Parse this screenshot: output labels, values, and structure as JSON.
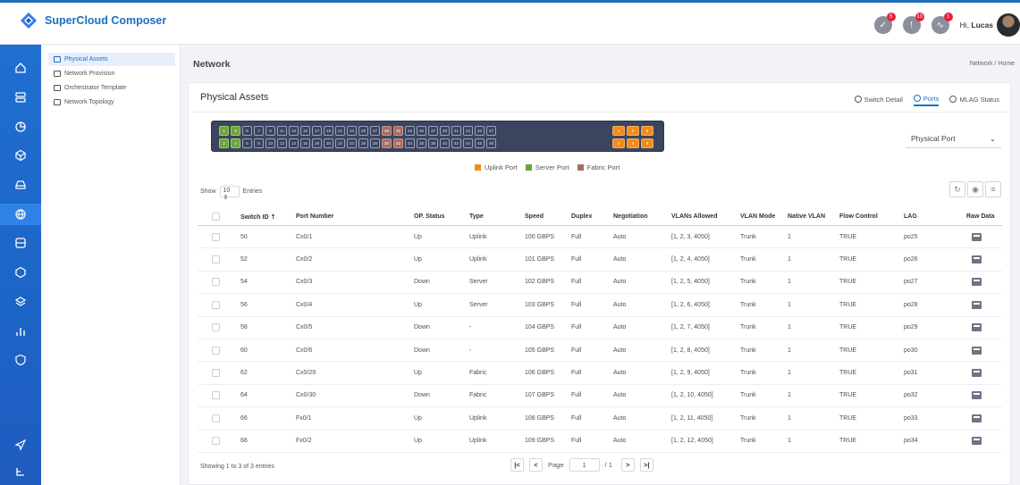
{
  "app": {
    "name": "SuperCloud Composer"
  },
  "header": {
    "greeting": "Hi, ",
    "user": "Lucas",
    "icons": [
      {
        "name": "tasks-icon",
        "badge": "5"
      },
      {
        "name": "alerts-icon",
        "badge": "13"
      },
      {
        "name": "activity-icon",
        "badge": "1"
      }
    ]
  },
  "rail": [
    "home-icon",
    "servers-icon",
    "dashboard-icon",
    "cube-icon",
    "storage-icon",
    "network-icon",
    "database-icon",
    "hexagon-icon",
    "layers-icon",
    "analytics-icon",
    "security-icon",
    "send-icon",
    "topology-icon"
  ],
  "subnav": [
    {
      "label": "Physical Assets",
      "active": true
    },
    {
      "label": "Network Provision",
      "active": false
    },
    {
      "label": "Orchestrator Template",
      "active": false
    },
    {
      "label": "Network Topology",
      "active": false
    }
  ],
  "page": {
    "title": "Network",
    "breadcrumb": "Network / Home"
  },
  "card": {
    "title": "Physical Assets",
    "tabs": [
      {
        "label": "Switch Detail",
        "active": false
      },
      {
        "label": "Ports",
        "active": true
      },
      {
        "label": "MLAG Status",
        "active": false
      }
    ],
    "view_select": "Physical Port"
  },
  "switch": {
    "top": [
      {
        "n": "1",
        "t": "server"
      },
      {
        "n": "3",
        "t": "server"
      },
      {
        "n": "5",
        "t": ""
      },
      {
        "n": "7",
        "t": ""
      },
      {
        "n": "9",
        "t": ""
      },
      {
        "n": "11",
        "t": ""
      },
      {
        "n": "13",
        "t": ""
      },
      {
        "n": "15",
        "t": ""
      },
      {
        "n": "17",
        "t": ""
      },
      {
        "n": "19",
        "t": ""
      },
      {
        "n": "21",
        "t": ""
      },
      {
        "n": "23",
        "t": ""
      },
      {
        "n": "25",
        "t": ""
      },
      {
        "n": "27",
        "t": ""
      },
      {
        "n": "29",
        "t": "fabric"
      },
      {
        "n": "31",
        "t": "fabric"
      },
      {
        "n": "33",
        "t": ""
      },
      {
        "n": "35",
        "t": ""
      },
      {
        "n": "37",
        "t": ""
      },
      {
        "n": "39",
        "t": ""
      },
      {
        "n": "41",
        "t": ""
      },
      {
        "n": "43",
        "t": ""
      },
      {
        "n": "45",
        "t": ""
      },
      {
        "n": "47",
        "t": ""
      }
    ],
    "bottom": [
      {
        "n": "2",
        "t": "server"
      },
      {
        "n": "4",
        "t": "server"
      },
      {
        "n": "6",
        "t": ""
      },
      {
        "n": "8",
        "t": ""
      },
      {
        "n": "10",
        "t": ""
      },
      {
        "n": "12",
        "t": ""
      },
      {
        "n": "14",
        "t": ""
      },
      {
        "n": "16",
        "t": ""
      },
      {
        "n": "18",
        "t": ""
      },
      {
        "n": "20",
        "t": ""
      },
      {
        "n": "22",
        "t": ""
      },
      {
        "n": "24",
        "t": ""
      },
      {
        "n": "26",
        "t": ""
      },
      {
        "n": "28",
        "t": ""
      },
      {
        "n": "30",
        "t": "fabric"
      },
      {
        "n": "32",
        "t": "fabric"
      },
      {
        "n": "34",
        "t": ""
      },
      {
        "n": "36",
        "t": ""
      },
      {
        "n": "38",
        "t": ""
      },
      {
        "n": "40",
        "t": ""
      },
      {
        "n": "42",
        "t": ""
      },
      {
        "n": "44",
        "t": ""
      },
      {
        "n": "46",
        "t": ""
      },
      {
        "n": "48",
        "t": ""
      }
    ],
    "uplink_top": [
      "1",
      "3",
      "5"
    ],
    "uplink_bottom": [
      "2",
      "4",
      "6"
    ],
    "legend": [
      {
        "label": "Uplink Port",
        "color": "#f08d1e"
      },
      {
        "label": "Server Port",
        "color": "#6ca33e"
      },
      {
        "label": "Fabric Port",
        "color": "#a86d63"
      }
    ]
  },
  "table": {
    "show_label": "Show",
    "entries_value": "10",
    "entries_label": "Entries",
    "columns": [
      "Switch ID",
      "Port Number",
      "OP. Status",
      "Type",
      "Speed",
      "Duplex",
      "Negotiation",
      "VLANs Allowed",
      "VLAN Mode",
      "Native VLAN",
      "Flow Control",
      "LAG",
      "Raw Data"
    ],
    "rows": [
      [
        "50",
        "Cx0/1",
        "Up",
        "Uplink",
        "100 GBPS",
        "Full",
        "Auto",
        "[1, 2, 3, 4050]",
        "Trunk",
        "1",
        "TRUE",
        "po25"
      ],
      [
        "52",
        "Cx0/2",
        "Up",
        "Uplink",
        "101 GBPS",
        "Full",
        "Auto",
        "[1, 2, 4, 4050]",
        "Trunk",
        "1",
        "TRUE",
        "po26"
      ],
      [
        "54",
        "Cx0/3",
        "Down",
        "Server",
        "102 GBPS",
        "Full",
        "Auto",
        "[1, 2, 5, 4050]",
        "Trunk",
        "1",
        "TRUE",
        "po27"
      ],
      [
        "56",
        "Cx0/4",
        "Up",
        "Server",
        "103 GBPS",
        "Full",
        "Auto",
        "[1, 2, 6, 4050]",
        "Trunk",
        "1",
        "TRUE",
        "po28"
      ],
      [
        "58",
        "Cx0/5",
        "Down",
        "-",
        "104 GBPS",
        "Full",
        "Auto",
        "[1, 2, 7, 4050]",
        "Trunk",
        "1",
        "TRUE",
        "po29"
      ],
      [
        "60",
        "Cx0/6",
        "Down",
        "-",
        "105 GBPS",
        "Full",
        "Auto",
        "[1, 2, 8, 4050]",
        "Trunk",
        "1",
        "TRUE",
        "po30"
      ],
      [
        "62",
        "Cx0/29",
        "Up",
        "Fabric",
        "106 GBPS",
        "Full",
        "Auto",
        "[1, 2, 9, 4050]",
        "Trunk",
        "1",
        "TRUE",
        "po31"
      ],
      [
        "64",
        "Cx0/30",
        "Down",
        "Fabric",
        "107 GBPS",
        "Full",
        "Auto",
        "[1, 2, 10, 4050]",
        "Trunk",
        "1",
        "TRUE",
        "po32"
      ],
      [
        "66",
        "Fx0/1",
        "Up",
        "Uplink",
        "108 GBPS",
        "Full",
        "Auto",
        "[1, 2, 11, 4050]",
        "Trunk",
        "1",
        "TRUE",
        "po33"
      ],
      [
        "68",
        "Fx0/2",
        "Up",
        "Uplink",
        "109 GBPS",
        "Full",
        "Auto",
        "[1, 2, 12, 4050]",
        "Trunk",
        "1",
        "TRUE",
        "po34"
      ]
    ],
    "footer": "Showing 1 to 3 of 3 entries",
    "pager": {
      "label": "Page",
      "current": "1",
      "total": "/ 1"
    }
  }
}
